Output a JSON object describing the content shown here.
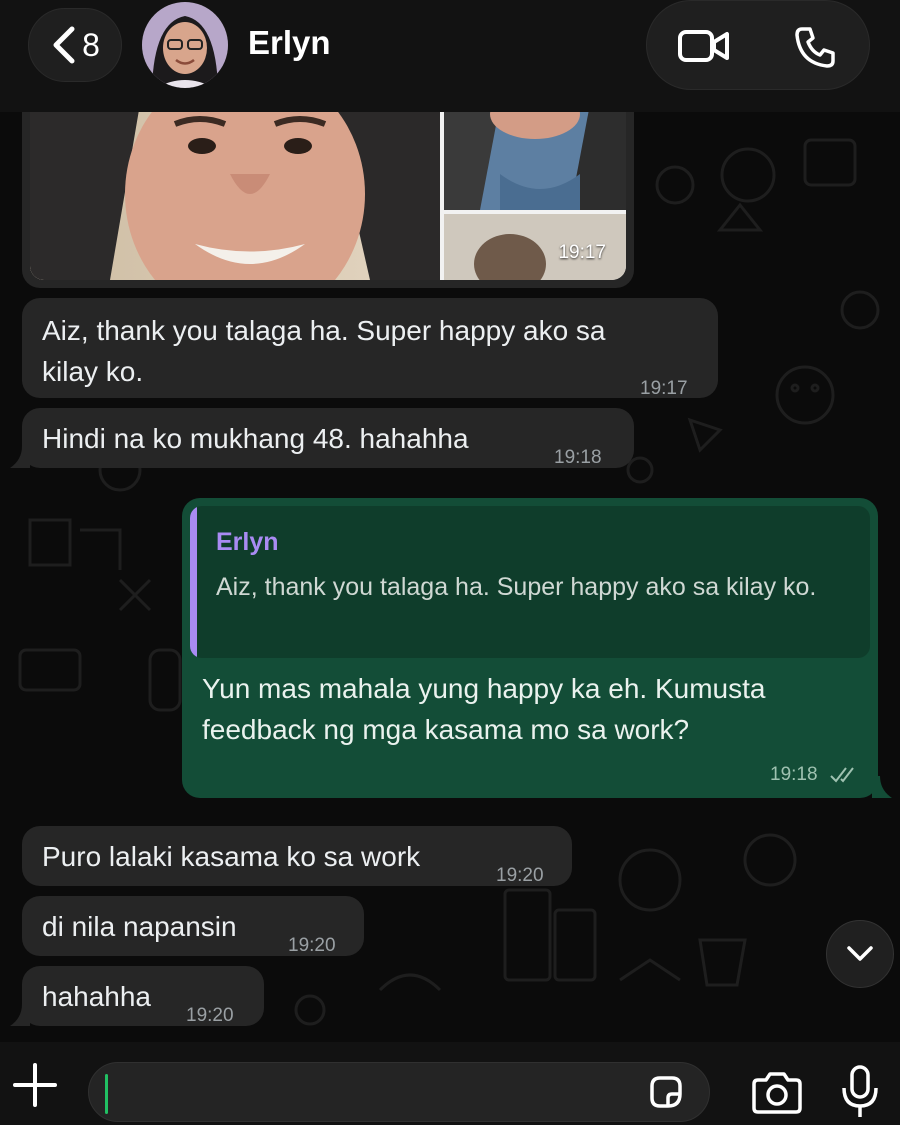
{
  "header": {
    "back_count": "8",
    "contact_name": "Erlyn"
  },
  "messages": {
    "media_time": "19:17",
    "m1_text": "Aiz, thank you talaga ha. Super happy ako sa\nkilay ko.",
    "m1_time": "19:17",
    "m2_text": "Hindi na ko mukhang 48. hahahha",
    "m2_time": "19:18",
    "reply": {
      "quoted_name": "Erlyn",
      "quoted_text": "Aiz, thank you talaga ha. Super happy ako sa kilay ko.",
      "text": "Yun mas mahala yung happy ka eh. Kumusta feedback ng mga kasama mo sa work?",
      "time": "19:18",
      "status_icon": "double-check-read-icon"
    },
    "m3_text": "Puro lalaki kasama ko sa work",
    "m3_time": "19:20",
    "m4_text": "di nila napansin",
    "m4_time": "19:20",
    "m5_text": "hahahha",
    "m5_time": "19:20"
  },
  "composer": {
    "placeholder": ""
  },
  "colors": {
    "incoming_bubble": "#262626",
    "outgoing_bubble": "#134d37",
    "quote_accent": "#a98bf3",
    "caret": "#21c063"
  }
}
